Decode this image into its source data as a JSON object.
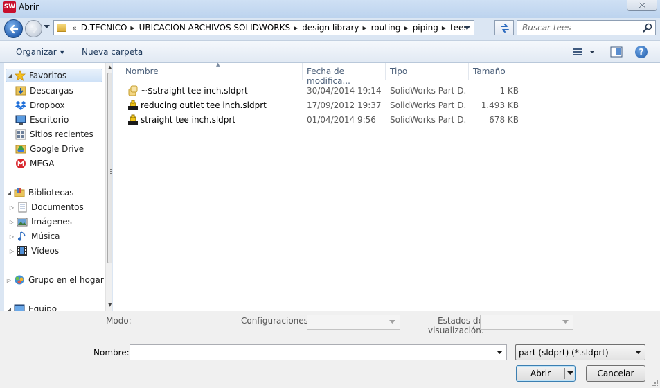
{
  "window": {
    "title": "Abrir",
    "app_badge": "SW"
  },
  "address": {
    "overflow": "«",
    "segments": [
      "D.TECNICO",
      "UBICACION ARCHIVOS SOLIDWORKS",
      "design library",
      "routing",
      "piping",
      "tees"
    ]
  },
  "search": {
    "placeholder": "Buscar tees"
  },
  "toolbar": {
    "organize_label": "Organizar",
    "new_folder_label": "Nueva carpeta"
  },
  "sidebar": {
    "favorites": {
      "label": "Favoritos",
      "items": [
        "Descargas",
        "Dropbox",
        "Escritorio",
        "Sitios recientes",
        "Google Drive",
        "MEGA"
      ]
    },
    "libraries": {
      "label": "Bibliotecas",
      "items": [
        "Documentos",
        "Imágenes",
        "Música",
        "Vídeos"
      ]
    },
    "homegroup": "Grupo en el hogar",
    "computer": "Equipo"
  },
  "file_list": {
    "columns": [
      "Nombre",
      "Fecha de modifica...",
      "Tipo",
      "Tamaño"
    ],
    "rows": [
      {
        "name": "~$straight tee inch.sldprt",
        "date": "30/04/2014 19:14",
        "type": "SolidWorks Part D...",
        "size": "1 KB",
        "icon": "temp-part-icon"
      },
      {
        "name": "reducing outlet tee inch.sldprt",
        "date": "17/09/2012 19:37",
        "type": "SolidWorks Part D...",
        "size": "1.493 KB",
        "icon": "part-icon"
      },
      {
        "name": "straight tee inch.sldprt",
        "date": "01/04/2014 9:56",
        "type": "SolidWorks Part D...",
        "size": "678 KB",
        "icon": "part-icon"
      }
    ]
  },
  "options": {
    "mode_label": "Modo:",
    "configs_label": "Configuraciones:",
    "display_states_label_1": "Estados de",
    "display_states_label_2": "visualización:"
  },
  "filename": {
    "label": "Nombre:",
    "value": ""
  },
  "filter": {
    "selected": "part (sldprt)  (*.sldprt)"
  },
  "buttons": {
    "open": "Abrir",
    "cancel": "Cancelar"
  }
}
